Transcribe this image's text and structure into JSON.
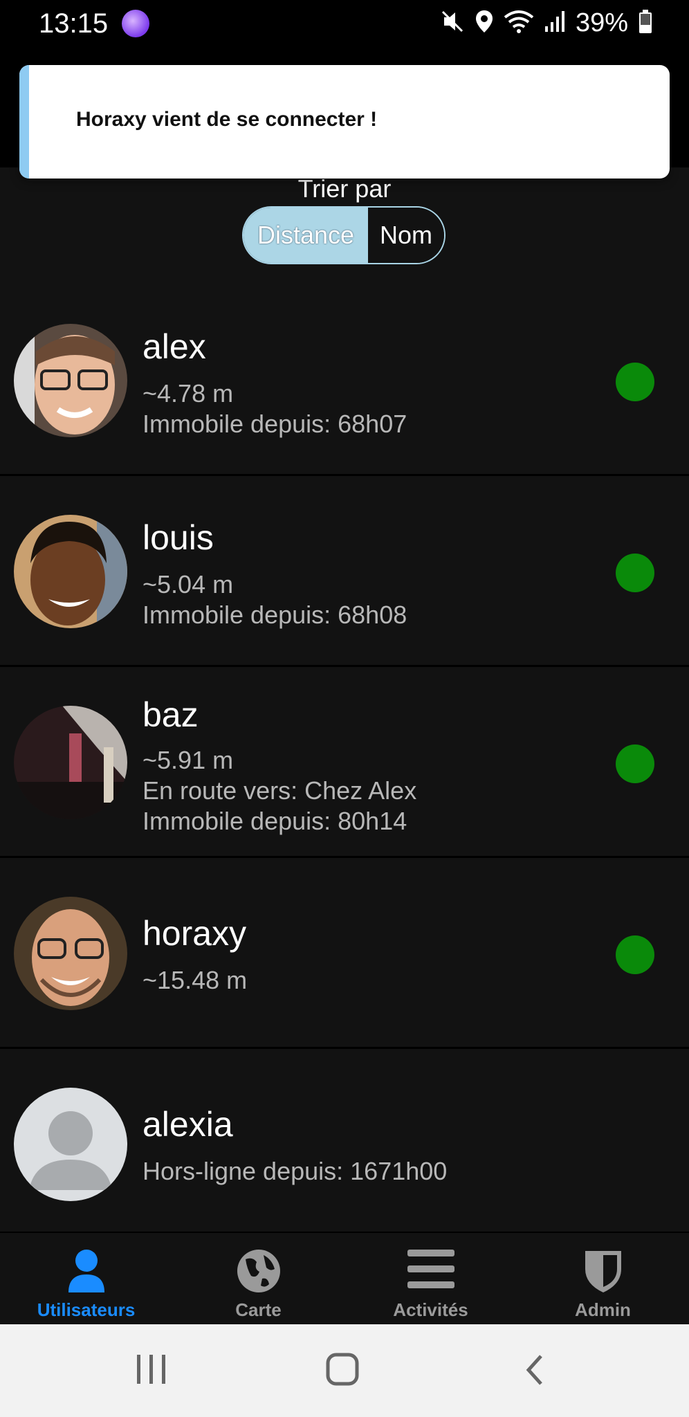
{
  "status_bar": {
    "time": "13:15",
    "battery_percent": "39%",
    "icons": [
      "app-notification-icon",
      "mute-icon",
      "location-icon",
      "wifi-icon",
      "signal-icon",
      "battery-icon"
    ]
  },
  "toast": {
    "message": "Horaxy vient de se connecter !",
    "accent_color": "#8ecbf2"
  },
  "sort": {
    "label": "Trier par",
    "options": [
      "Distance",
      "Nom"
    ],
    "selected": "Distance"
  },
  "users": [
    {
      "name": "alex",
      "lines": [
        "~4.78 m",
        "Immobile depuis: 68h07"
      ],
      "online": true
    },
    {
      "name": "louis",
      "lines": [
        "~5.04 m",
        "Immobile depuis: 68h08"
      ],
      "online": true
    },
    {
      "name": "baz",
      "lines": [
        "~5.91 m",
        "En route vers: Chez Alex",
        "Immobile depuis: 80h14"
      ],
      "online": true
    },
    {
      "name": "horaxy",
      "lines": [
        "~15.48 m"
      ],
      "online": true
    },
    {
      "name": "alexia",
      "lines": [
        "Hors-ligne depuis: 1671h00"
      ],
      "online": false
    }
  ],
  "nav": {
    "items": [
      {
        "label": "Utilisateurs",
        "icon": "user-icon",
        "active": true
      },
      {
        "label": "Carte",
        "icon": "globe-icon",
        "active": false
      },
      {
        "label": "Activités",
        "icon": "menu-icon",
        "active": false
      },
      {
        "label": "Admin",
        "icon": "shield-icon",
        "active": false
      }
    ]
  },
  "colors": {
    "background": "#121212",
    "online": "#0a8a0a",
    "active_nav": "#1a8cff",
    "sort_active": "#acd6e6"
  }
}
